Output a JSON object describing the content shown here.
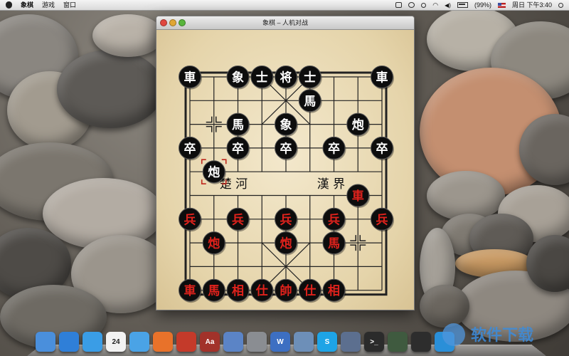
{
  "menubar": {
    "app_name": "象棋",
    "items": [
      "游戏",
      "窗口"
    ],
    "battery": "(99%)",
    "clock": "周日 下午3:40"
  },
  "window": {
    "title": "象棋 – 人机对战"
  },
  "board": {
    "river_left": "楚 河",
    "river_right": "漢 界",
    "selected_square": {
      "col": 1,
      "row": 4
    },
    "pieces": [
      {
        "char": "車",
        "side": "black",
        "col": 0,
        "row": 0
      },
      {
        "char": "象",
        "side": "black",
        "col": 2,
        "row": 0
      },
      {
        "char": "士",
        "side": "black",
        "col": 3,
        "row": 0
      },
      {
        "char": "将",
        "side": "black",
        "col": 4,
        "row": 0
      },
      {
        "char": "士",
        "side": "black",
        "col": 5,
        "row": 0
      },
      {
        "char": "車",
        "side": "black",
        "col": 8,
        "row": 0
      },
      {
        "char": "馬",
        "side": "black",
        "col": 5,
        "row": 1
      },
      {
        "char": "馬",
        "side": "black",
        "col": 2,
        "row": 2
      },
      {
        "char": "象",
        "side": "black",
        "col": 4,
        "row": 2
      },
      {
        "char": "炮",
        "side": "black",
        "col": 7,
        "row": 2
      },
      {
        "char": "卒",
        "side": "black",
        "col": 0,
        "row": 3
      },
      {
        "char": "卒",
        "side": "black",
        "col": 2,
        "row": 3
      },
      {
        "char": "卒",
        "side": "black",
        "col": 4,
        "row": 3
      },
      {
        "char": "卒",
        "side": "black",
        "col": 6,
        "row": 3
      },
      {
        "char": "卒",
        "side": "black",
        "col": 8,
        "row": 3
      },
      {
        "char": "炮",
        "side": "black",
        "col": 1,
        "row": 4
      },
      {
        "char": "車",
        "side": "red",
        "col": 7,
        "row": 5
      },
      {
        "char": "兵",
        "side": "red",
        "col": 0,
        "row": 6
      },
      {
        "char": "兵",
        "side": "red",
        "col": 2,
        "row": 6
      },
      {
        "char": "兵",
        "side": "red",
        "col": 4,
        "row": 6
      },
      {
        "char": "兵",
        "side": "red",
        "col": 6,
        "row": 6
      },
      {
        "char": "兵",
        "side": "red",
        "col": 8,
        "row": 6
      },
      {
        "char": "炮",
        "side": "red",
        "col": 1,
        "row": 7
      },
      {
        "char": "炮",
        "side": "red",
        "col": 4,
        "row": 7
      },
      {
        "char": "馬",
        "side": "red",
        "col": 6,
        "row": 7
      },
      {
        "char": "車",
        "side": "red",
        "col": 0,
        "row": 9
      },
      {
        "char": "馬",
        "side": "red",
        "col": 1,
        "row": 9
      },
      {
        "char": "相",
        "side": "red",
        "col": 2,
        "row": 9
      },
      {
        "char": "仕",
        "side": "red",
        "col": 3,
        "row": 9
      },
      {
        "char": "帥",
        "side": "red",
        "col": 4,
        "row": 9
      },
      {
        "char": "仕",
        "side": "red",
        "col": 5,
        "row": 9
      },
      {
        "char": "相",
        "side": "red",
        "col": 6,
        "row": 9
      }
    ],
    "empty_markers": [
      {
        "col": 1,
        "row": 2
      },
      {
        "col": 7,
        "row": 7
      }
    ]
  },
  "dock": {
    "icons": [
      {
        "name": "finder-icon",
        "color": "#4a8fdc"
      },
      {
        "name": "app-store-icon",
        "color": "#2f7fd8"
      },
      {
        "name": "itunes-icon",
        "color": "#3a9de6"
      },
      {
        "name": "calendar-icon",
        "color": "#f2f2f2",
        "label": "24"
      },
      {
        "name": "safari-icon",
        "color": "#4aa3e6"
      },
      {
        "name": "firefox-icon",
        "color": "#e8722a"
      },
      {
        "name": "parallels-icon",
        "color": "#c43a2a"
      },
      {
        "name": "dictionary-icon",
        "color": "#a2322a",
        "label": "Aa"
      },
      {
        "name": "xcode-icon",
        "color": "#5b84c6"
      },
      {
        "name": "system-preferences-icon",
        "color": "#8a8d92"
      },
      {
        "name": "word-icon",
        "color": "#3d6fc2",
        "label": "W"
      },
      {
        "name": "preview-icon",
        "color": "#6d8fb8"
      },
      {
        "name": "skype-icon",
        "color": "#1ea4e6",
        "label": "S"
      },
      {
        "name": "network-icon",
        "color": "#5c6f8f"
      },
      {
        "name": "terminal-icon",
        "color": "#2b2b2b",
        "label": ">_"
      },
      {
        "name": "activity-icon",
        "color": "#3f5a3f"
      },
      {
        "name": "qq-icon",
        "color": "#2d2d2d"
      },
      {
        "name": "ie-icon",
        "color": "#2a8fd8"
      }
    ]
  },
  "watermark": {
    "text": "软件下载"
  }
}
